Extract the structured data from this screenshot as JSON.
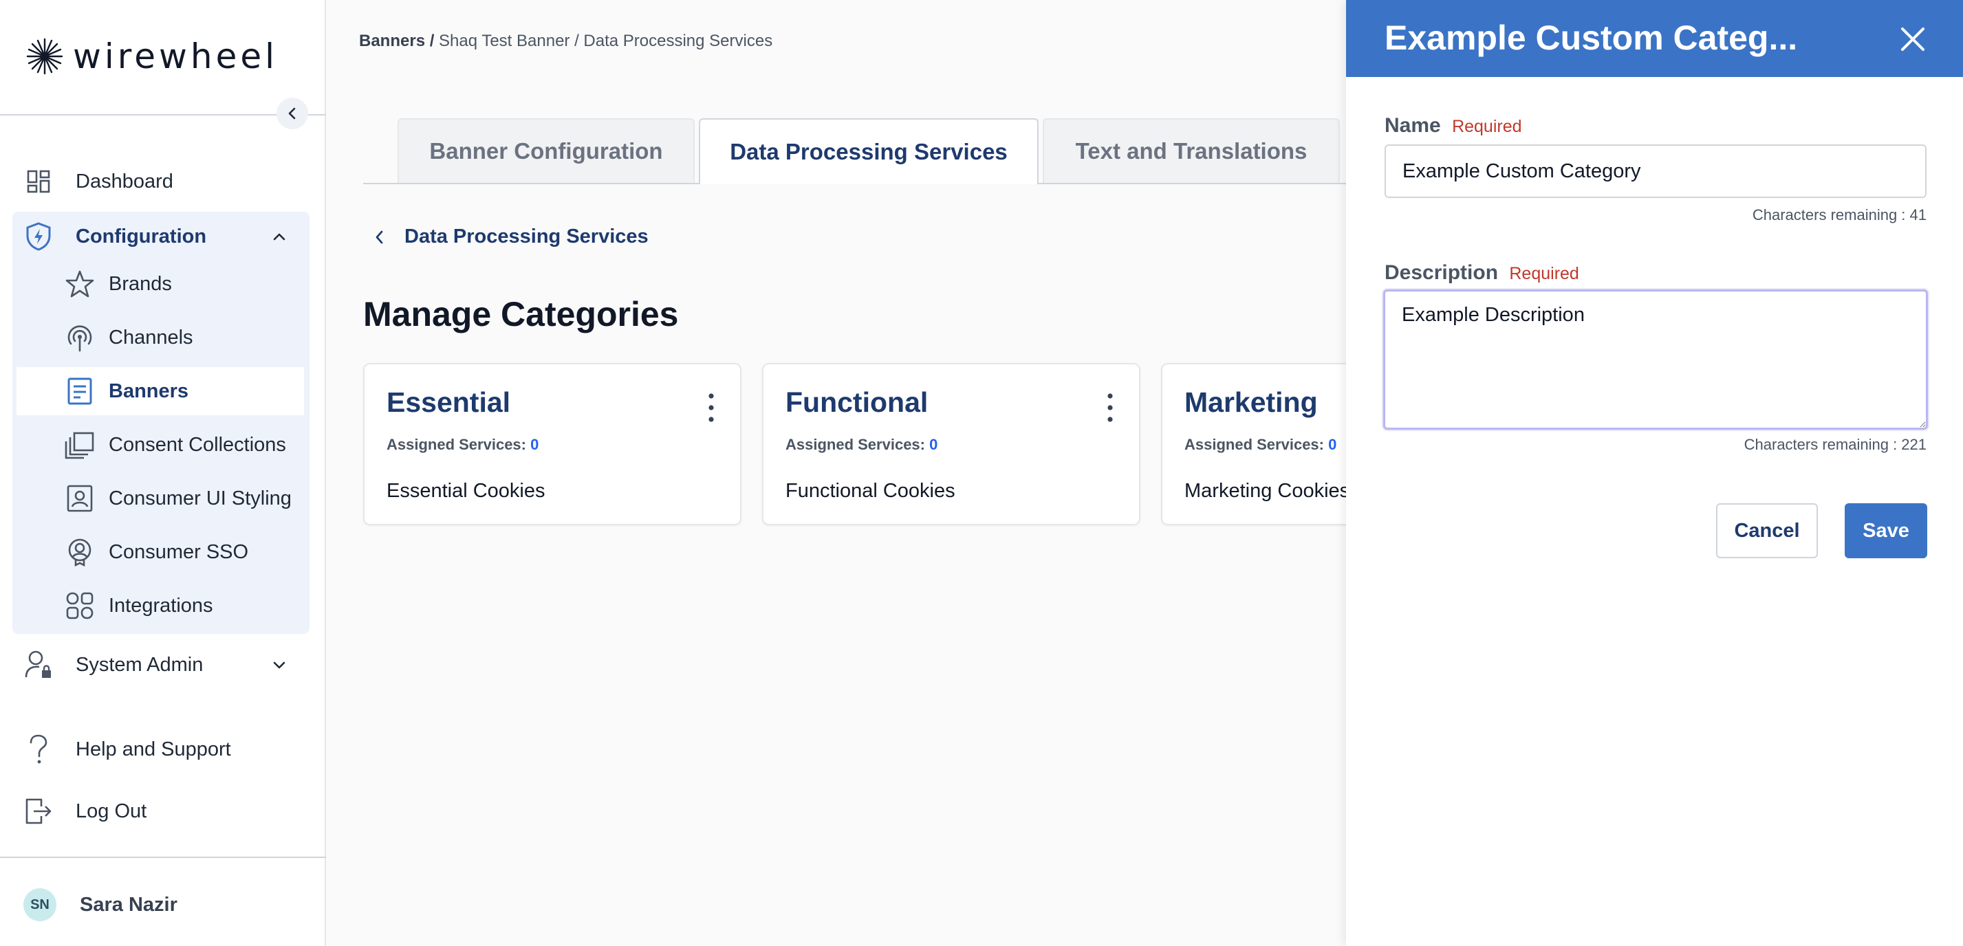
{
  "brand": {
    "name": "wirewheel",
    "accent": "#3b74c6",
    "navy": "#1e3a6e"
  },
  "sidebar": {
    "collapse_icon": "chevron-left-icon",
    "nav": {
      "dashboard": "Dashboard",
      "configuration": "Configuration",
      "system_admin": "System Admin",
      "help": "Help and Support",
      "logout": "Log Out"
    },
    "config_items": [
      {
        "label": "Brands",
        "icon": "star-icon"
      },
      {
        "label": "Channels",
        "icon": "broadcast-icon"
      },
      {
        "label": "Banners",
        "icon": "document-icon",
        "active": true
      },
      {
        "label": "Consent Collections",
        "icon": "stack-icon"
      },
      {
        "label": "Consumer UI Styling",
        "icon": "portrait-icon"
      },
      {
        "label": "Consumer SSO",
        "icon": "badge-icon"
      },
      {
        "label": "Integrations",
        "icon": "grid-icon"
      }
    ],
    "user": {
      "initials": "SN",
      "name": "Sara Nazir"
    }
  },
  "breadcrumb": {
    "root": "Banners /",
    "rest": "Shaq Test Banner / Data Processing Services"
  },
  "tabs": [
    "Banner Configuration",
    "Data Processing Services",
    "Text and Translations"
  ],
  "back_link": "Data Processing Services",
  "page_title": "Manage Categories",
  "cards": [
    {
      "title": "Essential",
      "assigned_label": "Assigned Services:",
      "assigned_count": "0",
      "description": "Essential Cookies"
    },
    {
      "title": "Functional",
      "assigned_label": "Assigned Services:",
      "assigned_count": "0",
      "description": "Functional Cookies"
    },
    {
      "title": "Marketing",
      "assigned_label": "Assigned Services:",
      "assigned_count": "0",
      "description": "Marketing Cookies"
    }
  ],
  "drawer": {
    "title": "Example Custom Categ...",
    "name_label": "Name",
    "required": "Required",
    "name_value": "Example Custom Category",
    "name_remaining": "Characters remaining : 41",
    "description_label": "Description",
    "description_value": "Example Description",
    "description_remaining": "Characters remaining : 221",
    "cancel": "Cancel",
    "save": "Save"
  }
}
